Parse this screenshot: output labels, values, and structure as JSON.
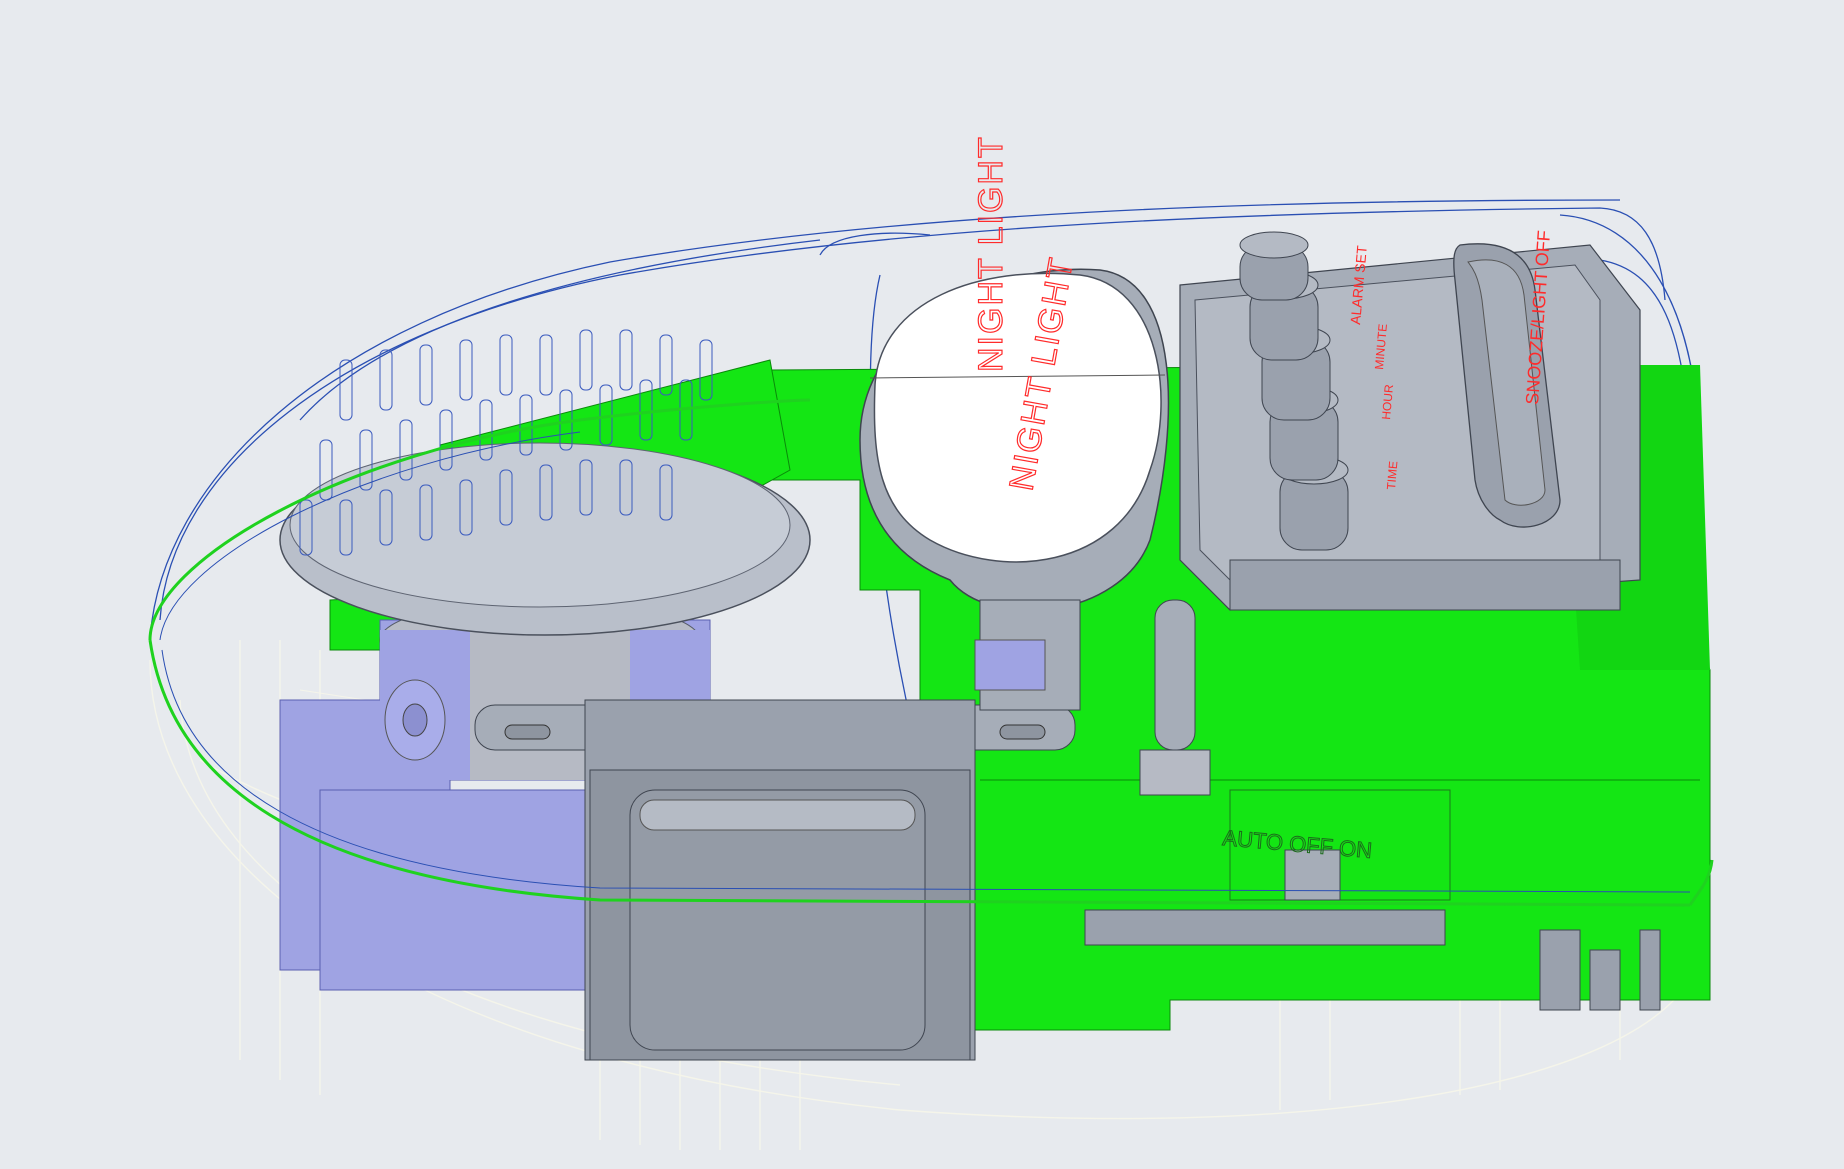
{
  "scene": {
    "background": "#e7eaee",
    "description_colors": {
      "pcb": "#14e614",
      "body_gray": "#a6adb8",
      "lavender": "#9fa3e3",
      "wire_blue": "#2a4fb3",
      "wire_white": "#f4f4ea",
      "label_red": "#ff2b2b"
    }
  },
  "labels": {
    "night_light_top": "NIGHT LIGHT",
    "night_light_bottom": "NIGHT LIGHT",
    "snooze": "SNOOZE/LIGHT OFF",
    "time": "TIME",
    "hour": "HOUR",
    "minute": "MINUTE",
    "alarm_set": "ALARM SET",
    "auto_off_on": "AUTO OFF ON"
  }
}
